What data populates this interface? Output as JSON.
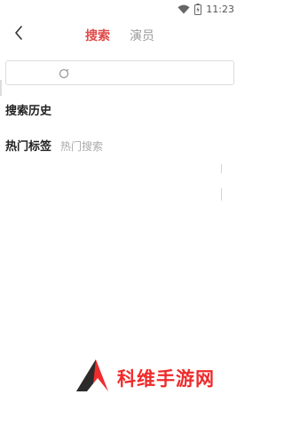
{
  "status_bar": {
    "time": "11:23",
    "battery_icon": "battery-charging-icon",
    "wifi_icon": "wifi-icon"
  },
  "header": {
    "back_icon": "chevron-left-icon",
    "tabs": [
      {
        "label": "搜索",
        "active": true
      },
      {
        "label": "演员",
        "active": false
      }
    ],
    "accent_color": "#e04848"
  },
  "search": {
    "value": "",
    "placeholder": "",
    "icon": "search-icon"
  },
  "history": {
    "title": "搜索历史"
  },
  "hot": {
    "title": "热门标签",
    "tags": [
      "热门搜索"
    ]
  },
  "watermark": {
    "text": "科维手游网"
  }
}
